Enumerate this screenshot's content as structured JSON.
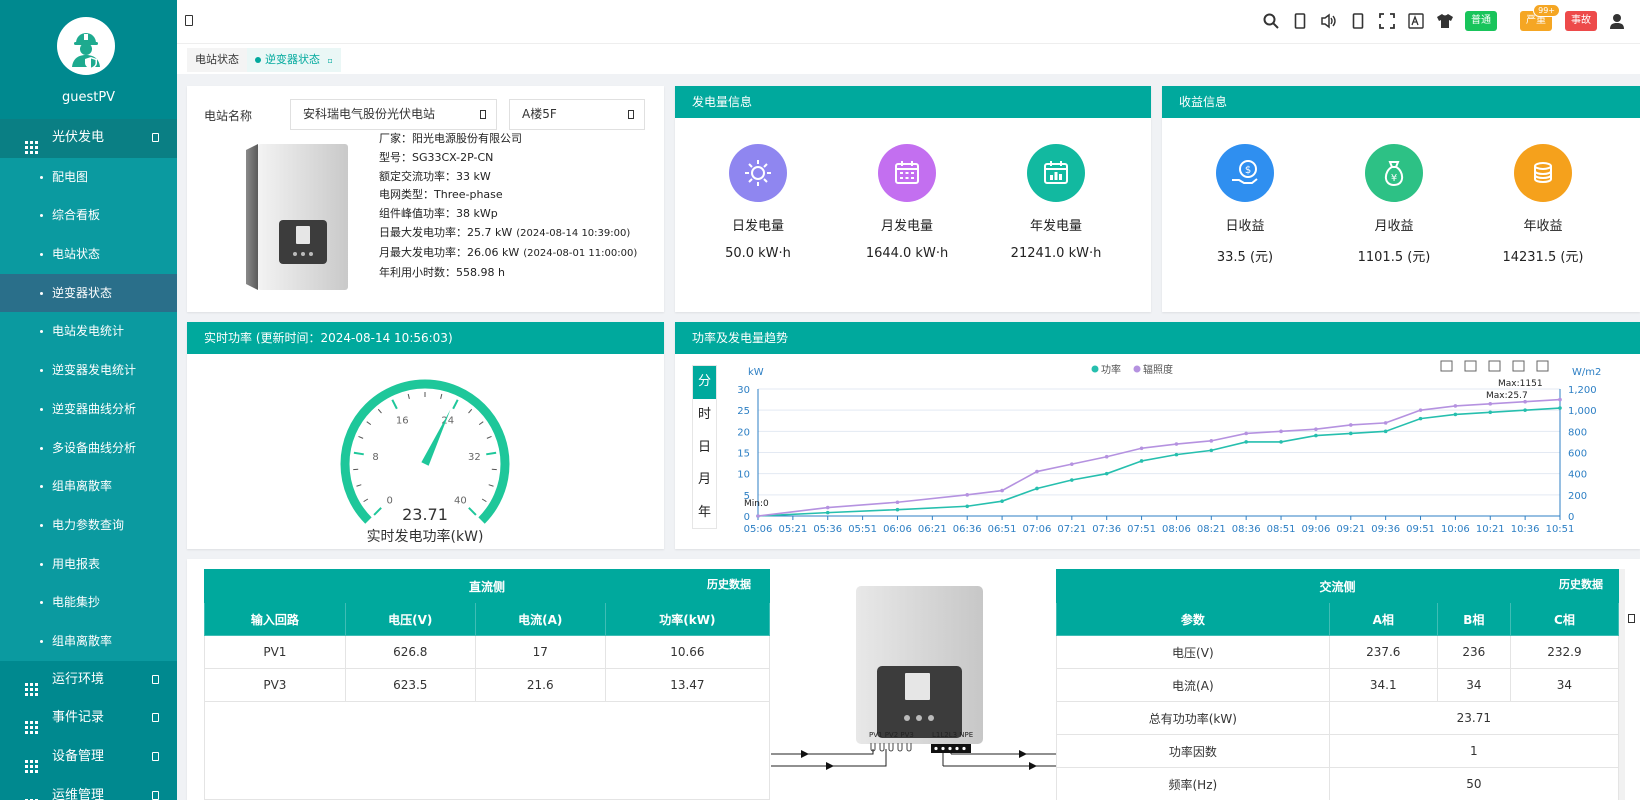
{
  "sidebar": {
    "username": "guestPV",
    "items": [
      {
        "label": "光伏发电",
        "type": "top",
        "open": true
      },
      {
        "label": "配电图",
        "type": "sub"
      },
      {
        "label": "综合看板",
        "type": "sub"
      },
      {
        "label": "电站状态",
        "type": "sub"
      },
      {
        "label": "逆变器状态",
        "type": "sub",
        "active": true
      },
      {
        "label": "电站发电统计",
        "type": "sub"
      },
      {
        "label": "逆变器发电统计",
        "type": "sub"
      },
      {
        "label": "逆变器曲线分析",
        "type": "sub"
      },
      {
        "label": "多设备曲线分析",
        "type": "sub"
      },
      {
        "label": "组串离散率",
        "type": "sub"
      },
      {
        "label": "电力参数查询",
        "type": "sub"
      },
      {
        "label": "用电报表",
        "type": "sub"
      },
      {
        "label": "电能集抄",
        "type": "sub"
      },
      {
        "label": "组串离散率",
        "type": "sub"
      },
      {
        "label": "运行环境",
        "type": "top"
      },
      {
        "label": "事件记录",
        "type": "top"
      },
      {
        "label": "设备管理",
        "type": "top"
      },
      {
        "label": "运维管理",
        "type": "top"
      }
    ]
  },
  "topbar": {
    "badges": [
      {
        "label": "普通",
        "color": "#19c45b"
      },
      {
        "label": "严重",
        "color": "#f5a623",
        "count": "99+"
      },
      {
        "label": "事故",
        "color": "#ed4a4a"
      }
    ]
  },
  "tabs": [
    {
      "label": "电站状态",
      "active": false
    },
    {
      "label": "逆变器状态",
      "active": true
    }
  ],
  "station": {
    "label": "电站名称",
    "name": "安科瑞电气股份光伏电站",
    "building": "A楼5F",
    "specs": [
      {
        "text": "厂家：阳光电源股份有限公司",
        "note": ""
      },
      {
        "text": "型号：SG33CX-2P-CN",
        "note": ""
      },
      {
        "text": "额定交流功率：33 kW",
        "note": ""
      },
      {
        "text": "电网类型：Three-phase",
        "note": ""
      },
      {
        "text": "组件峰值功率：38 kWp",
        "note": ""
      },
      {
        "text": "日最大发电功率：25.7 kW",
        "note": "(2024-08-14 10:39:00)"
      },
      {
        "text": "月最大发电功率：26.06 kW",
        "note": "(2024-08-01 11:00:00)"
      },
      {
        "text": "年利用小时数：558.98 h",
        "note": ""
      }
    ]
  },
  "generation": {
    "title": "发电量信息",
    "items": [
      {
        "label": "日发电量",
        "value": "50.0 kW·h",
        "icon": "sun-icon",
        "color": "#8f86f0"
      },
      {
        "label": "月发电量",
        "value": "1644.0 kW·h",
        "icon": "calendar-month-icon",
        "color": "#c36ff0"
      },
      {
        "label": "年发电量",
        "value": "21241.0 kW·h",
        "icon": "calendar-year-icon",
        "color": "#12b9a0"
      }
    ]
  },
  "revenue": {
    "title": "收益信息",
    "items": [
      {
        "label": "日收益",
        "value": "33.5 (元)",
        "icon": "coin-hand-icon",
        "color": "#2f8ff0"
      },
      {
        "label": "月收益",
        "value": "1101.5 (元)",
        "icon": "money-bag-icon",
        "color": "#2dc185"
      },
      {
        "label": "年收益",
        "value": "14231.5 (元)",
        "icon": "coin-stack-icon",
        "color": "#f5a11c"
      }
    ]
  },
  "realtime": {
    "title": "实时功率 (更新时间：2024-08-14 10:56:03)",
    "value": 23.71,
    "value_text": "23.71",
    "caption": "实时发电功率(kW)",
    "min": 0,
    "max": 40,
    "tick_labels": [
      "0",
      "8",
      "16",
      "24",
      "32",
      "40"
    ],
    "accent": "#1ec79a"
  },
  "trend": {
    "title": "功率及发电量趋势",
    "periods": [
      "分",
      "时",
      "日",
      "月",
      "年"
    ],
    "active_period": "分"
  },
  "chart_data": {
    "type": "line",
    "title": "",
    "legend": [
      "功率",
      "辐照度"
    ],
    "legend_position": "top-center",
    "ylabel_left": "kW",
    "ylabel_right": "W/m2",
    "ylim_left": [
      0,
      30
    ],
    "ylim_right": [
      0,
      1200
    ],
    "yticks_left": [
      "0",
      "5",
      "10",
      "15",
      "20",
      "25",
      "30"
    ],
    "yticks_right": [
      "0",
      "200",
      "400",
      "600",
      "800",
      "1,000",
      "1,200"
    ],
    "xticks": [
      "05:06",
      "05:21",
      "05:36",
      "05:51",
      "06:06",
      "06:21",
      "06:36",
      "06:51",
      "07:06",
      "07:21",
      "07:36",
      "07:51",
      "08:06",
      "08:21",
      "08:36",
      "08:51",
      "09:06",
      "09:21",
      "09:36",
      "09:51",
      "10:06",
      "10:21",
      "10:36",
      "10:51"
    ],
    "grid": true,
    "annotations": [
      "Min:0",
      "Max:1151",
      "Max:25.7"
    ],
    "series": [
      {
        "name": "功率",
        "axis": "left",
        "color": "#26bfae",
        "x": [
          "05:06",
          "05:36",
          "06:06",
          "06:36",
          "06:51",
          "07:06",
          "07:21",
          "07:36",
          "07:51",
          "08:06",
          "08:21",
          "08:36",
          "08:51",
          "09:06",
          "09:21",
          "09:36",
          "09:51",
          "10:06",
          "10:21",
          "10:36",
          "10:51"
        ],
        "values": [
          0,
          0.8,
          1.5,
          2.3,
          3.5,
          6.5,
          8.5,
          10,
          13,
          14.5,
          15.5,
          17.5,
          17.5,
          19,
          19.5,
          20,
          23,
          24,
          24.5,
          25,
          25.5
        ]
      },
      {
        "name": "辐照度",
        "axis": "right",
        "color": "#b592e0",
        "x": [
          "05:06",
          "05:36",
          "06:06",
          "06:36",
          "06:51",
          "07:06",
          "07:21",
          "07:36",
          "07:51",
          "08:06",
          "08:21",
          "08:36",
          "08:51",
          "09:06",
          "09:21",
          "09:36",
          "09:51",
          "10:06",
          "10:21",
          "10:36",
          "10:51"
        ],
        "values": [
          0,
          80,
          130,
          200,
          240,
          420,
          490,
          560,
          640,
          680,
          710,
          780,
          800,
          820,
          860,
          880,
          1000,
          1040,
          1060,
          1080,
          1100
        ]
      }
    ]
  },
  "dc_table": {
    "title": "直流侧",
    "history": "历史数据",
    "headers": [
      "输入回路",
      "电压(V)",
      "电流(A)",
      "功率(kW)"
    ],
    "rows": [
      [
        "PV1",
        "626.8",
        "17",
        "10.66"
      ],
      [
        "PV3",
        "623.5",
        "21.6",
        "13.47"
      ]
    ]
  },
  "diagram": {
    "dc_terminals": "PV1 PV2 PV3",
    "ac_terminals": "L1L2L3 NPE"
  },
  "ac_table": {
    "title": "交流侧",
    "history": "历史数据",
    "headers": [
      "参数",
      "A相",
      "B相",
      "C相"
    ],
    "rows": [
      [
        "电压(V)",
        "237.6",
        "236",
        "232.9"
      ],
      [
        "电流(A)",
        "34.1",
        "34",
        "34"
      ]
    ],
    "merged_rows": [
      [
        "总有功功率(kW)",
        "23.71"
      ],
      [
        "功率因数",
        "1"
      ],
      [
        "频率(Hz)",
        "50"
      ]
    ]
  }
}
